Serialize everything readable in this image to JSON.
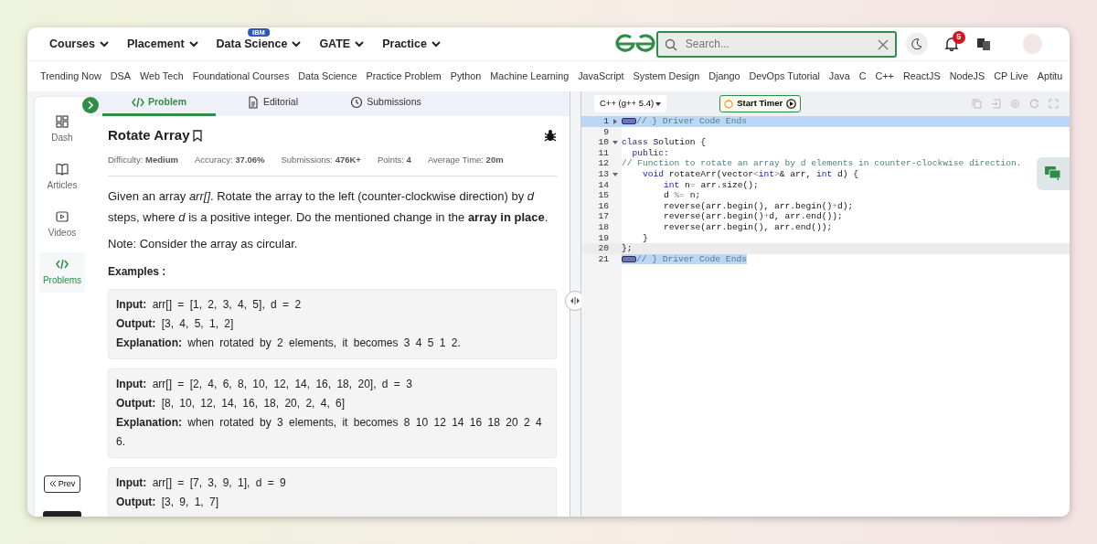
{
  "top_nav": {
    "menus": [
      {
        "label": "Courses"
      },
      {
        "label": "Placement"
      },
      {
        "label": "Data Science",
        "badge": "IBM"
      },
      {
        "label": "GATE"
      },
      {
        "label": "Practice"
      }
    ],
    "search": {
      "placeholder": "Search..."
    },
    "notifications": {
      "count": "5"
    }
  },
  "topics": [
    "Trending Now",
    "DSA",
    "Web Tech",
    "Foundational Courses",
    "Data Science",
    "Practice Problem",
    "Python",
    "Machine Learning",
    "JavaScript",
    "System Design",
    "Django",
    "DevOps Tutorial",
    "Java",
    "C",
    "C++",
    "ReactJS",
    "NodeJS",
    "CP Live",
    "Aptitu"
  ],
  "sidebar": {
    "items": [
      {
        "label": "Dash",
        "selected": false
      },
      {
        "label": "Articles",
        "selected": false
      },
      {
        "label": "Videos",
        "selected": false
      },
      {
        "label": "Problems",
        "selected": true
      }
    ],
    "prev_label": "Prev"
  },
  "tabs": [
    {
      "label": "Problem",
      "selected": true
    },
    {
      "label": "Editorial",
      "selected": false
    },
    {
      "label": "Submissions",
      "selected": false
    }
  ],
  "problem": {
    "title": "Rotate Array",
    "meta": [
      {
        "label": "Difficulty:",
        "value": "Medium"
      },
      {
        "label": "Accuracy:",
        "value": "37.06%"
      },
      {
        "label": "Submissions:",
        "value": "476K+"
      },
      {
        "label": "Points:",
        "value": "4"
      },
      {
        "label": "Average Time:",
        "value": "20m"
      }
    ],
    "description": "Given an array *arr[]*. Rotate the array to the left (counter-clockwise direction) by *d* steps, where *d* is a positive integer. Do the mentioned change in the **array in place**.",
    "note": "Note: Consider the array as circular.",
    "examples_heading": "Examples :",
    "examples": [
      [
        {
          "label": "Input:",
          "text": "arr[] = [1, 2, 3, 4, 5], d = 2"
        },
        {
          "label": "Output:",
          "text": "[3, 4, 5, 1, 2]"
        },
        {
          "label": "Explanation:",
          "text": "when rotated by 2 elements, it becomes 3 4 5 1 2."
        }
      ],
      [
        {
          "label": "Input:",
          "text": "arr[] = [2, 4, 6, 8, 10, 12, 14, 16, 18, 20], d = 3"
        },
        {
          "label": "Output:",
          "text": "[8, 10, 12, 14, 16, 18, 20, 2, 4, 6]"
        },
        {
          "label": "Explanation:",
          "text": "when rotated by 3 elements, it becomes 8 10 12 14 16 18 20 2 4 6."
        }
      ],
      [
        {
          "label": "Input:",
          "text": "arr[] = [7, 3, 9, 1], d = 9"
        },
        {
          "label": "Output:",
          "text": "[3, 9, 1, 7]"
        }
      ]
    ]
  },
  "editor": {
    "language": "C++ (g++ 5.4)",
    "timer_label": "Start Timer",
    "lines": [
      {
        "number": "1",
        "expanded": false,
        "selected": true,
        "active": true,
        "folded_marker": true,
        "tokens": [
          {
            "kind": "comment",
            "s": "// } Driver Code Ends"
          }
        ]
      },
      {
        "number": "9",
        "selected": false,
        "active": false,
        "folded_marker": false
      },
      {
        "number": "10",
        "expanded": true,
        "selected": false,
        "active": false,
        "folded_marker": false,
        "tokens": [
          {
            "kind": "keyword",
            "s": "class"
          },
          {
            "kind": "plain",
            "s": " Solution {"
          }
        ]
      },
      {
        "number": "11",
        "selected": false,
        "active": false,
        "folded_marker": false,
        "tokens": [
          {
            "kind": "keyword",
            "s": "  public"
          },
          {
            "kind": "plain",
            "s": ":"
          }
        ]
      },
      {
        "number": "12",
        "selected": false,
        "active": false,
        "folded_marker": false,
        "tokens": [
          {
            "kind": "comment",
            "s": "// Function to rotate an array by d elements in counter-clockwise direction."
          }
        ]
      },
      {
        "number": "13",
        "expanded": true,
        "selected": false,
        "active": false,
        "folded_marker": false,
        "tokens": [
          {
            "kind": "keyword",
            "s": "    void"
          },
          {
            "kind": "plain",
            "s": " rotateArr(vector"
          },
          {
            "kind": "op",
            "s": "<"
          },
          {
            "kind": "keyword",
            "s": "int"
          },
          {
            "kind": "op",
            "s": ">"
          },
          {
            "kind": "plain",
            "s": "& arr, "
          },
          {
            "kind": "keyword",
            "s": "int"
          },
          {
            "kind": "plain",
            "s": " d) {"
          }
        ]
      },
      {
        "number": "14",
        "selected": false,
        "active": false,
        "folded_marker": false,
        "tokens": [
          {
            "kind": "keyword",
            "s": "        int"
          },
          {
            "kind": "plain",
            "s": " n"
          },
          {
            "kind": "op",
            "s": "="
          },
          {
            "kind": "plain",
            "s": " arr.size();"
          }
        ]
      },
      {
        "number": "15",
        "selected": false,
        "active": false,
        "folded_marker": false,
        "tokens": [
          {
            "kind": "plain",
            "s": "        d "
          },
          {
            "kind": "op",
            "s": "%="
          },
          {
            "kind": "plain",
            "s": " n;"
          }
        ]
      },
      {
        "number": "16",
        "selected": false,
        "active": false,
        "folded_marker": false,
        "tokens": [
          {
            "kind": "plain",
            "s": "        reverse(arr.begin(), arr.begin()"
          },
          {
            "kind": "op",
            "s": "+"
          },
          {
            "kind": "plain",
            "s": "d);"
          }
        ]
      },
      {
        "number": "17",
        "selected": false,
        "active": false,
        "folded_marker": false,
        "tokens": [
          {
            "kind": "plain",
            "s": "        reverse(arr.begin()"
          },
          {
            "kind": "op",
            "s": "+"
          },
          {
            "kind": "plain",
            "s": "d, arr.end());"
          }
        ]
      },
      {
        "number": "18",
        "selected": false,
        "active": false,
        "folded_marker": false,
        "tokens": [
          {
            "kind": "plain",
            "s": "        reverse(arr.begin(), arr.end());"
          }
        ]
      },
      {
        "number": "19",
        "selected": false,
        "active": false,
        "folded_marker": false,
        "tokens": [
          {
            "kind": "plain",
            "s": "    }"
          }
        ]
      },
      {
        "number": "20",
        "selected": false,
        "active": true,
        "folded_marker": false,
        "tokens": [
          {
            "kind": "plain",
            "s": "};"
          }
        ]
      },
      {
        "number": "21",
        "selected": true,
        "active": false,
        "folded_marker": true,
        "tokens": [
          {
            "kind": "comment",
            "s": "// } Driver Code Ends"
          }
        ]
      }
    ]
  }
}
